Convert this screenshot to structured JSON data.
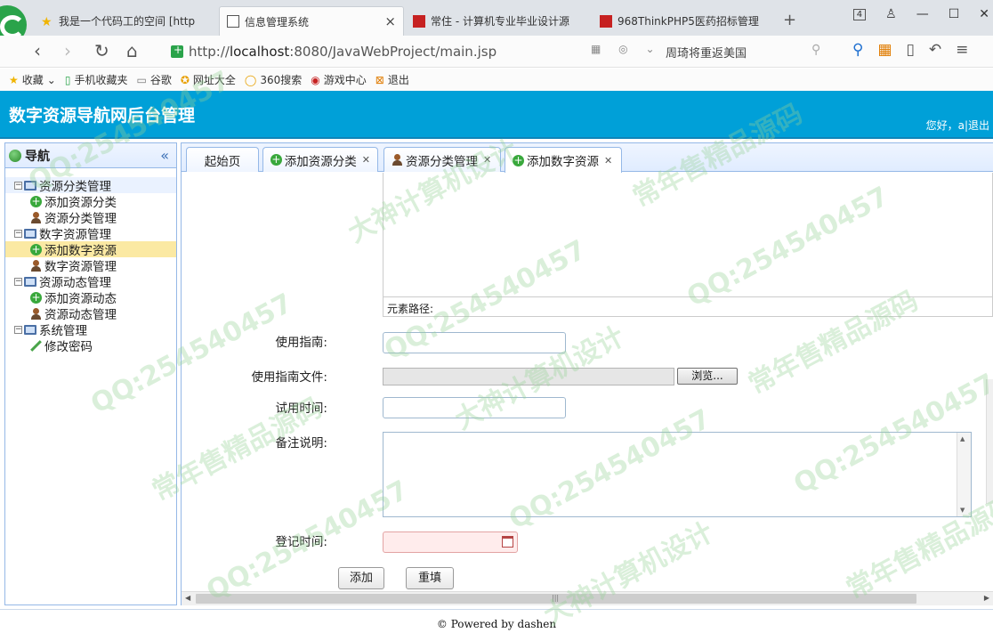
{
  "browser": {
    "tabs": [
      {
        "label": "我是一个代码工的空间 [http"
      },
      {
        "label": "信息管理系统"
      },
      {
        "label": "常住 - 计算机专业毕业设计源"
      },
      {
        "label": "968ThinkPHP5医药招标管理"
      }
    ],
    "tab_count": "4",
    "url_prefix": "http://",
    "url_host": "localhost",
    "url_rest": ":8080/JavaWebProject/main.jsp",
    "search_hint": "周琦将重返美国"
  },
  "bookmarks": [
    {
      "label": "收藏",
      "icon": "star-icon"
    },
    {
      "label": "手机收藏夹",
      "icon": "phone-icon"
    },
    {
      "label": "谷歌",
      "icon": "page-icon"
    },
    {
      "label": "网址大全",
      "icon": "compass-icon"
    },
    {
      "label": "360搜索",
      "icon": "search-ring-icon"
    },
    {
      "label": "游戏中心",
      "icon": "game-icon"
    },
    {
      "label": "退出",
      "icon": "exit-icon"
    }
  ],
  "app": {
    "title": "数字资源导航网后台管理",
    "greeting": "您好，a|退出"
  },
  "sidebar": {
    "title": "导航",
    "groups": [
      {
        "label": "资源分类管理",
        "items": [
          "添加资源分类",
          "资源分类管理"
        ]
      },
      {
        "label": "数字资源管理",
        "items": [
          "添加数字资源",
          "数字资源管理"
        ]
      },
      {
        "label": "资源动态管理",
        "items": [
          "添加资源动态",
          "资源动态管理"
        ]
      },
      {
        "label": "系统管理",
        "items": [
          "修改密码"
        ]
      }
    ]
  },
  "tabs": [
    {
      "label": "起始页"
    },
    {
      "label": "添加资源分类"
    },
    {
      "label": "资源分类管理"
    },
    {
      "label": "添加数字资源"
    }
  ],
  "form": {
    "element_path": "元素路径:",
    "guide_label": "使用指南:",
    "guide_file_label": "使用指南文件:",
    "browse_label": "浏览...",
    "trial_label": "试用时间:",
    "remark_label": "备注说明:",
    "reg_time_label": "登记时间:",
    "add_label": "添加",
    "reset_label": "重填"
  },
  "footer": {
    "text": "© Powered by dashen"
  },
  "watermarks": [
    "QQ:254540457",
    "常年售精品源码",
    "大神计算机设计"
  ]
}
